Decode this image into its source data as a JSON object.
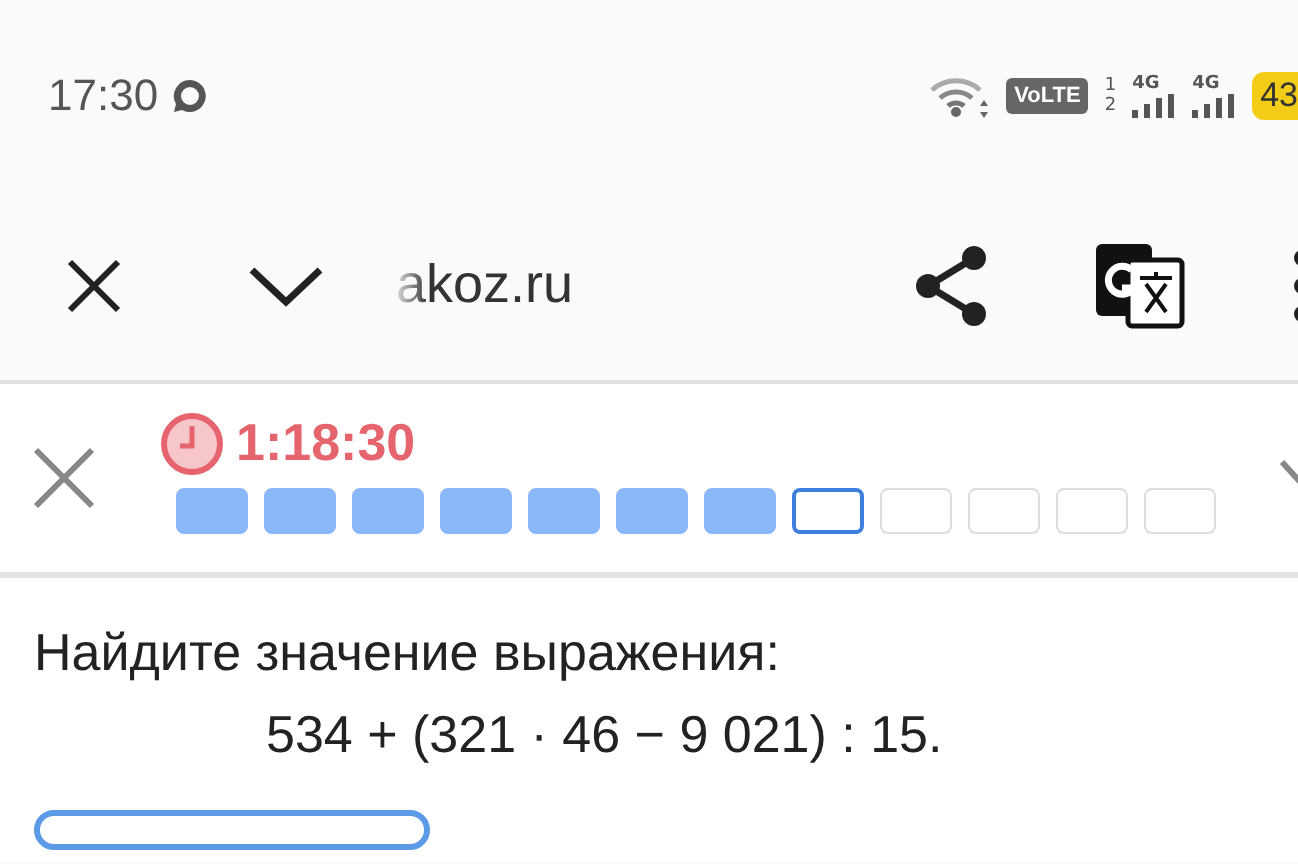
{
  "status_bar": {
    "time": "17:30",
    "volte": "VoLTE",
    "sim_1": "1",
    "sim_2": "2",
    "network_1": "4G",
    "network_2": "4G",
    "battery": "43"
  },
  "toolbar": {
    "url": "akoz.ru"
  },
  "quiz_bar": {
    "timer": "1:18:30",
    "questions": [
      {
        "done": true,
        "selected": false
      },
      {
        "done": true,
        "selected": false
      },
      {
        "done": true,
        "selected": false
      },
      {
        "done": true,
        "selected": false
      },
      {
        "done": true,
        "selected": false
      },
      {
        "done": true,
        "selected": false
      },
      {
        "done": true,
        "selected": false
      },
      {
        "done": false,
        "selected": true
      },
      {
        "done": false,
        "selected": false
      },
      {
        "done": false,
        "selected": false
      },
      {
        "done": false,
        "selected": false
      },
      {
        "done": false,
        "selected": false
      }
    ]
  },
  "task": {
    "prompt": "Найдите значение выражения:",
    "expression": "534 + (321 · 46 − 9 021) : 15."
  }
}
